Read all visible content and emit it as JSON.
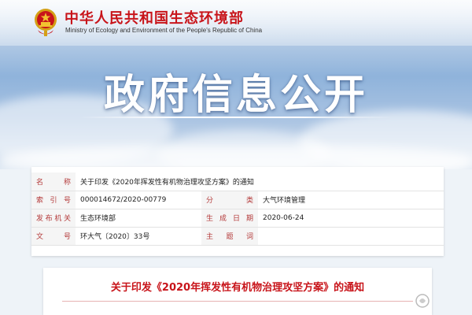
{
  "header": {
    "ministry_name_cn": "中华人民共和国生态环境部",
    "ministry_name_en": "Ministry of Ecology and Environment of the People's Republic of China",
    "banner_title": "政府信息公开"
  },
  "info_table": {
    "rows": [
      {
        "label": "名    称",
        "value": "关于印发《2020年挥发性有机物治理攻坚方案》的通知"
      },
      {
        "label": "索 引 号",
        "value": "000014672/2020-00779",
        "label2": "分    类",
        "value2": "大气环境管理"
      },
      {
        "label": "发布机关",
        "value": "生态环境部",
        "label2": "生成日期",
        "value2": "2020-06-24"
      },
      {
        "label": "文    号",
        "value": "环大气〔2020〕33号",
        "label2": "主 题 词",
        "value2": ""
      }
    ]
  },
  "notice": {
    "title": "关于印发《2020年挥发性有机物治理攻坚方案》的通知"
  },
  "colors": {
    "brand_red": "#c8141a",
    "label_red": "#b43a3a",
    "sky_blue": "#8fb3db"
  },
  "icons": {
    "emblem": "national-emblem-icon",
    "watermark": "watermark-logo-icon"
  }
}
